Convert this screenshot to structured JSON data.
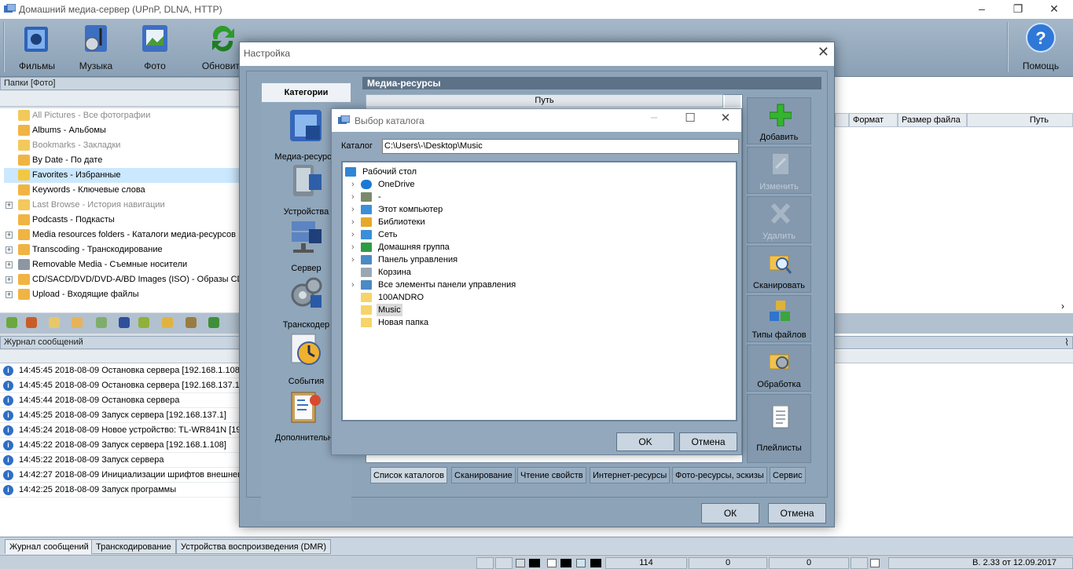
{
  "window": {
    "title": "Домашний медиа-сервер (UPnP, DLNA, HTTP)"
  },
  "toolbar": {
    "buttons": [
      "Фильмы",
      "Музыка",
      "Фото",
      "Обновить"
    ],
    "help": "Помощь"
  },
  "folders_pane": {
    "header": "Папки [Фото]",
    "items": [
      {
        "label": "All Pictures - Все фотографии",
        "dim": true,
        "expand": false
      },
      {
        "label": "Albums - Альбомы",
        "dim": false,
        "expand": false
      },
      {
        "label": "Bookmarks - Закладки",
        "dim": true,
        "expand": false
      },
      {
        "label": "By Date - По дате",
        "dim": false,
        "expand": false
      },
      {
        "label": "Favorites - Избранные",
        "dim": false,
        "expand": false,
        "selected": true
      },
      {
        "label": "Keywords - Ключевые слова",
        "dim": false,
        "expand": false
      },
      {
        "label": "Last Browse - История навигации",
        "dim": true,
        "expand": true
      },
      {
        "label": "Podcasts - Подкасты",
        "dim": false,
        "expand": false
      },
      {
        "label": "Media resources folders - Каталоги медиа-ресурсов",
        "dim": false,
        "expand": true
      },
      {
        "label": "Transcoding - Транскодирование",
        "dim": false,
        "expand": true
      },
      {
        "label": "Removable Media - Съемные носители",
        "dim": false,
        "expand": true
      },
      {
        "label": "CD/SACD/DVD/DVD-A/BD Images (ISO) - Образы CD/SACD/DVD/DVD-A/BD (ISO)",
        "dim": false,
        "expand": true
      },
      {
        "label": "Upload - Входящие файлы",
        "dim": false,
        "expand": true
      }
    ]
  },
  "log_pane": {
    "header": "Журнал сообщений",
    "rows": [
      "14:45:45 2018-08-09 Остановка сервера [192.168.1.108]",
      "14:45:45 2018-08-09 Остановка сервера [192.168.137.1]",
      "14:45:44 2018-08-09 Остановка сервера",
      "14:45:25 2018-08-09 Запуск сервера [192.168.137.1]",
      "14:45:24 2018-08-09 Новое устройство: TL-WR841N [192.168.1.1]",
      "14:45:22 2018-08-09 Запуск сервера [192.168.1.108]",
      "14:45:22 2018-08-09 Запуск сервера",
      "14:42:27 2018-08-09 Инициализации шрифтов внешнего вида",
      "14:42:25 2018-08-09 Запуск программы"
    ]
  },
  "bottom_tabs": [
    "Журнал сообщений",
    "Транскодирование",
    "Устройства воспроизведения (DMR)"
  ],
  "right_columns": [
    "Формат",
    "Размер файла",
    "Путь"
  ],
  "statusbar": {
    "count1": "114",
    "count2": "0",
    "count3": "0",
    "version": "В. 2.33 от 12.09.2017"
  },
  "settings_dialog": {
    "title": "Настройка",
    "categories_header": "Категории",
    "categories": [
      "Медиа-ресурсы",
      "Устройства",
      "Сервер",
      "Транскодер",
      "События",
      "Дополнительно"
    ],
    "section_title": "Медиа-ресурсы",
    "path_column": "Путь",
    "actions": [
      {
        "label": "Добавить",
        "enabled": true
      },
      {
        "label": "Изменить",
        "enabled": false
      },
      {
        "label": "Удалить",
        "enabled": false
      },
      {
        "label": "Сканировать",
        "enabled": true
      },
      {
        "label": "Типы файлов",
        "enabled": true
      },
      {
        "label": "Обработка",
        "enabled": true
      },
      {
        "label": "Плейлисты",
        "enabled": true
      }
    ],
    "tabs": [
      "Список каталогов",
      "Сканирование",
      "Чтение свойств",
      "Интернет-ресурсы",
      "Фото-ресурсы, эскизы",
      "Сервис"
    ],
    "ok": "ОК",
    "cancel": "Отмена"
  },
  "folder_dialog": {
    "title": "Выбор каталога",
    "catalog_label": "Каталог",
    "catalog_value": "C:\\Users\\-\\Desktop\\Music",
    "tree": [
      {
        "label": "Рабочий стол",
        "chevron": false,
        "indent": 0,
        "icon": "desktop"
      },
      {
        "label": "OneDrive",
        "chevron": true,
        "indent": 1,
        "icon": "cloud"
      },
      {
        "label": "-",
        "chevron": true,
        "indent": 1,
        "icon": "user"
      },
      {
        "label": "Этот компьютер",
        "chevron": true,
        "indent": 1,
        "icon": "computer"
      },
      {
        "label": "Библиотеки",
        "chevron": true,
        "indent": 1,
        "icon": "library"
      },
      {
        "label": "Сеть",
        "chevron": true,
        "indent": 1,
        "icon": "network"
      },
      {
        "label": "Домашняя группа",
        "chevron": true,
        "indent": 1,
        "icon": "homegroup"
      },
      {
        "label": "Панель управления",
        "chevron": true,
        "indent": 1,
        "icon": "control-panel"
      },
      {
        "label": "Корзина",
        "chevron": false,
        "indent": 1,
        "icon": "recycle-bin"
      },
      {
        "label": "Все элементы панели управления",
        "chevron": true,
        "indent": 1,
        "icon": "control-panel"
      },
      {
        "label": "100ANDRO",
        "chevron": false,
        "indent": 1,
        "icon": "folder"
      },
      {
        "label": "Music",
        "chevron": false,
        "indent": 1,
        "icon": "folder",
        "selected": true
      },
      {
        "label": "Новая папка",
        "chevron": false,
        "indent": 1,
        "icon": "folder"
      }
    ],
    "ok": "OK",
    "cancel": "Отмена"
  }
}
